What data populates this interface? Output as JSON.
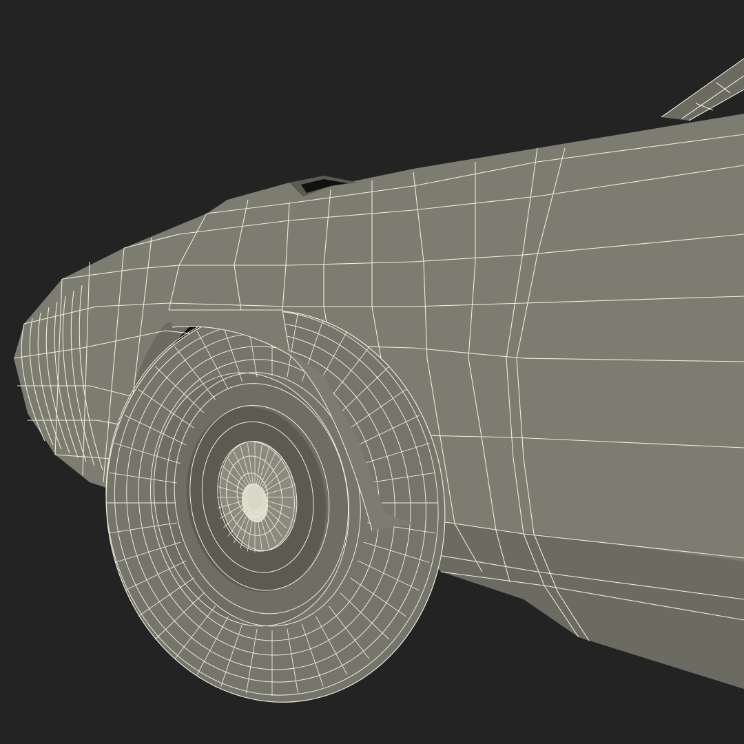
{
  "scene": {
    "subject": "car-front-fender-wireframe",
    "colors": {
      "background": "#232323",
      "body": "#7c7c71",
      "body_shade": "#6b6b61",
      "body_dark": "#5b5b52",
      "tire": "#75756b",
      "rim": "#6e6e64",
      "hub": "#8a8a7f",
      "cavity": "#101010",
      "wire": "#eeeeda"
    }
  }
}
